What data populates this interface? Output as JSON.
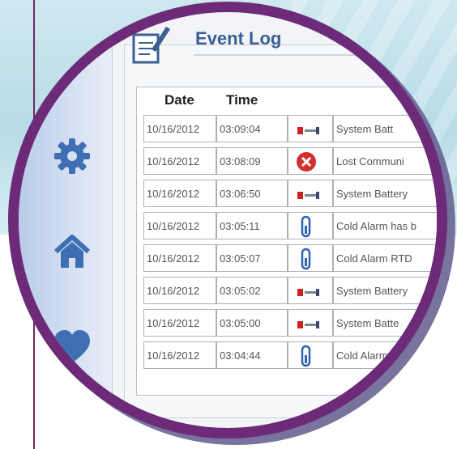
{
  "header": {
    "title": "Event Log"
  },
  "columns": {
    "date": "Date",
    "time": "Time"
  },
  "rows": [
    {
      "date": "10/16/2012",
      "time": "03:09:04",
      "icon": "battery-icon",
      "message": "System Batt"
    },
    {
      "date": "10/16/2012",
      "time": "03:08:09",
      "icon": "error-icon",
      "message": "Lost Communi"
    },
    {
      "date": "10/16/2012",
      "time": "03:06:50",
      "icon": "battery-icon",
      "message": "System Battery"
    },
    {
      "date": "10/16/2012",
      "time": "03:05:11",
      "icon": "thermometer-icon",
      "message": "Cold Alarm has b"
    },
    {
      "date": "10/16/2012",
      "time": "03:05:07",
      "icon": "thermometer-icon",
      "message": "Cold Alarm RTD"
    },
    {
      "date": "10/16/2012",
      "time": "03:05:02",
      "icon": "battery-icon",
      "message": "System Battery"
    },
    {
      "date": "10/16/2012",
      "time": "03:05:00",
      "icon": "battery-icon",
      "message": "System Batte"
    },
    {
      "date": "10/16/2012",
      "time": "03:04:44",
      "icon": "thermometer-icon",
      "message": "Cold Alarm"
    }
  ],
  "colors": {
    "lens": "#6c2a78",
    "title": "#3b5f93",
    "error": "#d32f2f"
  }
}
